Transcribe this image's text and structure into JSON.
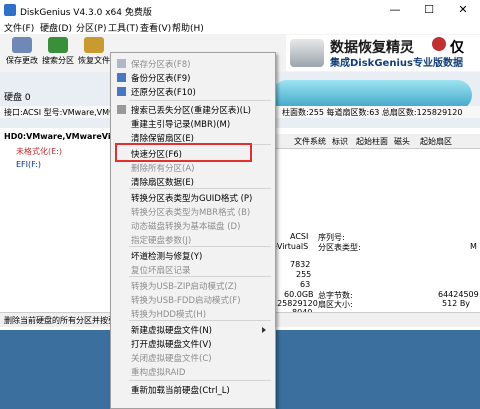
{
  "window": {
    "title": "DiskGenius V4.3.0 x64 免费版",
    "minimize": "—",
    "maximize": "☐",
    "close": "✕"
  },
  "menubar": [
    "文件(F)",
    "硬盘(D)",
    "分区(P)",
    "工具(T)",
    "查看(V)",
    "帮助(H)"
  ],
  "toolbar": [
    {
      "label": "保存更改",
      "color": "#6e88b8"
    },
    {
      "label": "搜索分区",
      "color": "#3a8f3a"
    },
    {
      "label": "恢复文件",
      "color": "#c89a30"
    }
  ],
  "banner": {
    "t1": "数据恢复精灵",
    "t2": "集成DiskGenius专业版数据",
    "t3": "仅"
  },
  "disk": {
    "label": "硬盘 0",
    "num": "0"
  },
  "infobar": {
    "left": "接口:ACSI  型号:VMware,VMwa",
    "right": "柱面数:255  每道扇区数:63  总扇区数:125829120"
  },
  "tree": [
    "HD0:VMware,VMwareVi",
    "未格式化(E:)",
    "EFI(F:)"
  ],
  "columns": [
    "文件系统",
    "标识",
    "起始柱面",
    "磁头",
    "起始扇区"
  ],
  "right_info": {
    "r1a": "ACSI",
    "r1b": "序列号:",
    "r2a": "eVirtualS",
    "r2b": "分区表类型:",
    "r2c": "M",
    "n1": "7832",
    "n2": "255",
    "n3": "63",
    "n4": "60.0GB",
    "r4b": "总字节数:",
    "r4c": "64424509",
    "n5": "125829120",
    "r5b": "扇区大小:",
    "r5c": "512 By",
    "n6": "8040"
  },
  "status": "删除当前硬盘的所有分区并按要",
  "context_menu": [
    {
      "label": "保存分区表(F8)",
      "enabled": false,
      "icon": "#b0b8c8"
    },
    {
      "label": "备份分区表(F9)",
      "enabled": true,
      "icon": "#4a77c4"
    },
    {
      "label": "还原分区表(F10)",
      "enabled": true,
      "icon": "#4a77c4"
    },
    {
      "label": "搜索已丢失分区(重建分区表)(L)",
      "enabled": true,
      "icon": "#999999"
    },
    {
      "label": "重建主引导记录(MBR)(M)",
      "enabled": true,
      "icon": ""
    },
    {
      "label": "清除保留扇区(E)",
      "enabled": true,
      "icon": ""
    },
    {
      "label": "快速分区(F6)",
      "enabled": true,
      "icon": ""
    },
    {
      "label": "删除所有分区(A)",
      "enabled": false,
      "icon": ""
    },
    {
      "label": "清除扇区数据(E)",
      "enabled": true,
      "icon": ""
    },
    {
      "label": "转换分区表类型为GUID格式 (P)",
      "enabled": true,
      "icon": ""
    },
    {
      "label": "转换分区表类型为MBR格式 (B)",
      "enabled": false,
      "icon": ""
    },
    {
      "label": "动态磁盘转换为基本磁盘 (D)",
      "enabled": false,
      "icon": ""
    },
    {
      "label": "指定硬盘参数(J)",
      "enabled": false,
      "icon": ""
    },
    {
      "label": "坏道检测与修复(Y)",
      "enabled": true,
      "icon": ""
    },
    {
      "label": "复位坏扇区记录",
      "enabled": false,
      "icon": ""
    },
    {
      "label": "转换为USB-ZIP启动模式(Z)",
      "enabled": false,
      "icon": ""
    },
    {
      "label": "转换为USB-FDD启动模式(F)",
      "enabled": false,
      "icon": ""
    },
    {
      "label": "转换为HDD模式(H)",
      "enabled": false,
      "icon": ""
    },
    {
      "label": "新建虚拟硬盘文件(N)",
      "enabled": true,
      "icon": ""
    },
    {
      "label": "打开虚拟硬盘文件(V)",
      "enabled": true,
      "icon": ""
    },
    {
      "label": "关闭虚拟硬盘文件(C)",
      "enabled": false,
      "icon": ""
    },
    {
      "label": "重构虚拟RAID",
      "enabled": false,
      "icon": ""
    },
    {
      "label": "重新加载当前硬盘(Ctrl_L)",
      "enabled": true,
      "icon": ""
    }
  ],
  "colors": {
    "highlight": "#e0312e",
    "accent": "#2f6fc8"
  }
}
